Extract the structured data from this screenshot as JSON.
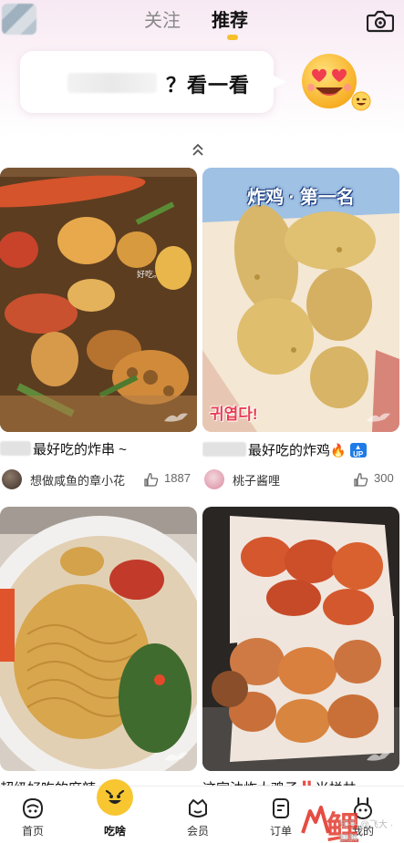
{
  "header": {
    "tabs": [
      {
        "label": "关注",
        "active": false
      },
      {
        "label": "推荐",
        "active": true
      }
    ],
    "accent": "#f5c02a",
    "camera_icon": "camera-icon"
  },
  "search_prompt": {
    "text": "？看一看"
  },
  "feed": {
    "collapse_icon": "chevron-double-up-icon",
    "cards": [
      {
        "title": "最好吃的炸串 ~",
        "author": "想做咸鱼的章小花",
        "likes": "1887",
        "photo_caption": "好吃。"
      },
      {
        "title": "最好吃的炸鸡",
        "title_emoji": "🔥",
        "title_badge": "UP",
        "author": "桃子酱哩",
        "likes": "300",
        "photo_banner": "炸鸡 · 第一名",
        "photo_sticker": "귀엽다!"
      },
      {
        "title": "超级好吃的麻辣",
        "author": "",
        "likes": ""
      },
      {
        "title": "这家油炸大鸡子‼️米栏丼",
        "author": "",
        "likes": ""
      }
    ]
  },
  "bottom_nav": {
    "items": [
      {
        "label": "首页",
        "icon": "home-face-icon"
      },
      {
        "label": "吃啥",
        "icon": "grin-face-icon",
        "active": true
      },
      {
        "label": "会员",
        "icon": "crown-face-icon"
      },
      {
        "label": "订单",
        "icon": "order-icon"
      },
      {
        "label": "我的",
        "icon": "bunny-face-icon"
      }
    ]
  },
  "brand": {
    "mark": "鲤",
    "sub": "知乎 @飞大 · 麒麟"
  }
}
